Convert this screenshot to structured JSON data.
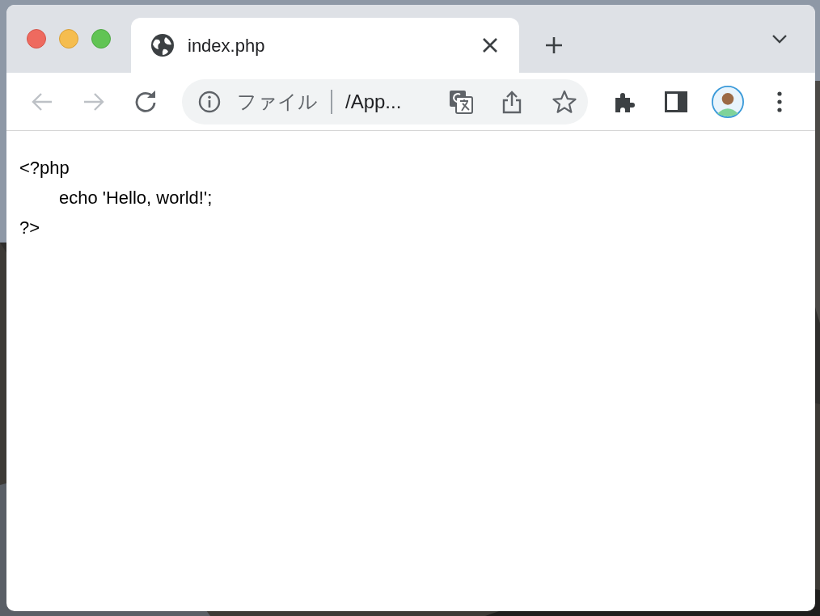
{
  "tabs": [
    {
      "title": "index.php",
      "selected": true
    }
  ],
  "toolbar": {
    "back_disabled": true,
    "forward_disabled": true
  },
  "address_bar": {
    "scheme_label": "ファイル",
    "url": "/App..."
  },
  "page": {
    "lines": [
      "<?php",
      "\techo 'Hello, world!';",
      "?>"
    ]
  }
}
